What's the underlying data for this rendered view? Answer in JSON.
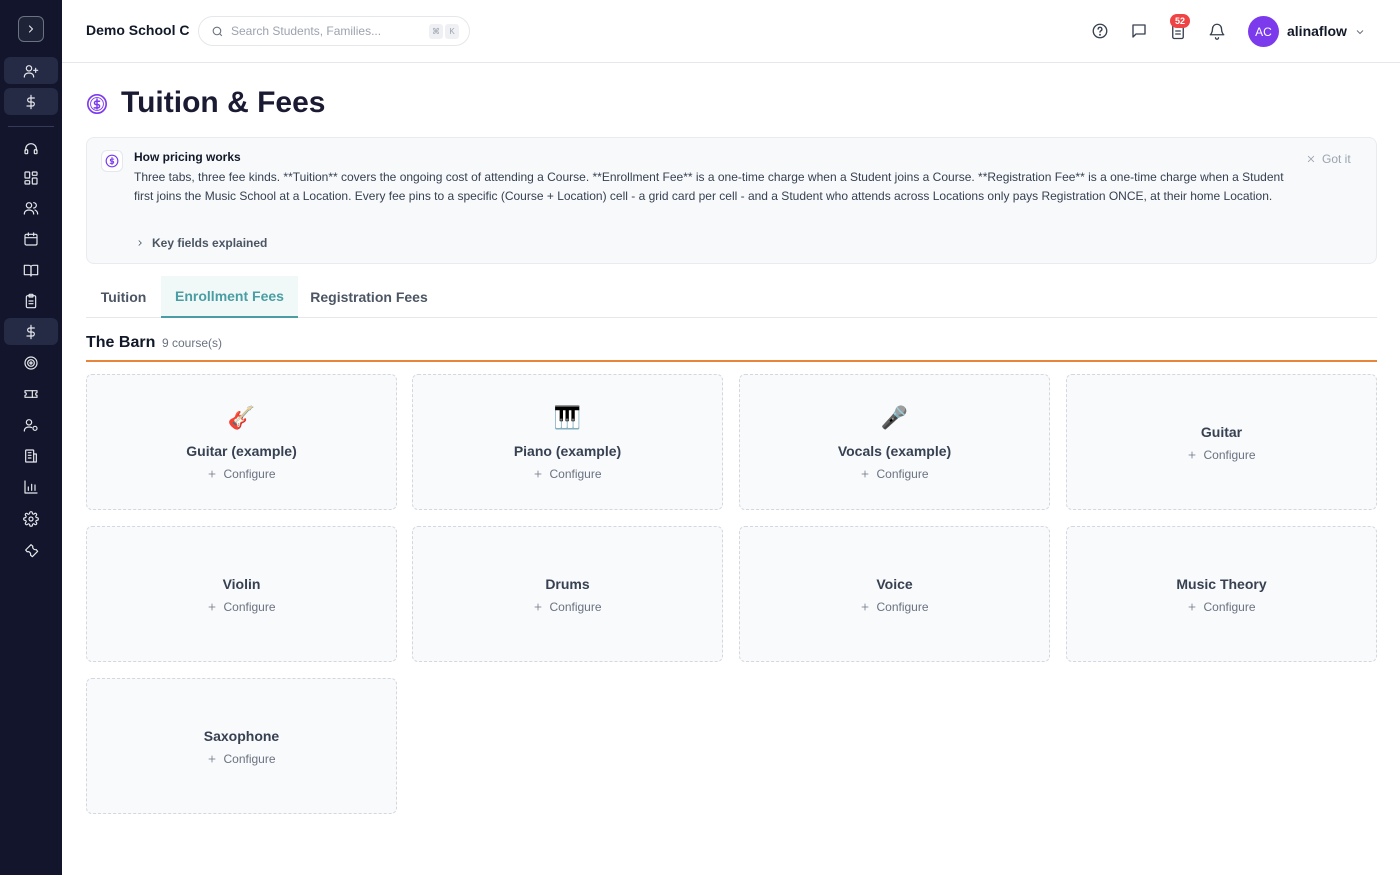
{
  "header": {
    "school_name": "Demo School C",
    "search_placeholder": "Search Students, Families...",
    "search_shortcut": [
      "⌘",
      "K"
    ],
    "notification_badge": "52",
    "avatar_initials": "AC",
    "username": "alinaflow"
  },
  "page": {
    "title": "Tuition & Fees",
    "icon": "dollar-circle-icon"
  },
  "info": {
    "title": "How pricing works",
    "body": "Three tabs, three fee kinds. **Tuition** covers the ongoing cost of attending a Course. **Enrollment Fee** is a one-time charge when a Student joins a Course. **Registration Fee** is a one-time charge when a Student first joins the Music School at a Location. Every fee pins to a specific (Course + Location) cell - a grid card per cell - and a Student who attends across Locations only pays Registration ONCE, at their home Location.",
    "dismiss_label": "Got it",
    "key_fields_label": "Key fields explained"
  },
  "tabs": [
    {
      "label": "Tuition",
      "active": false
    },
    {
      "label": "Enrollment Fees",
      "active": true
    },
    {
      "label": "Registration Fees",
      "active": false
    }
  ],
  "location": {
    "name": "The Barn",
    "count": "9 course(s)"
  },
  "configure_label": "Configure",
  "courses": [
    {
      "name": "Guitar (example)",
      "emoji": "🎸"
    },
    {
      "name": "Piano (example)",
      "emoji": "🎹"
    },
    {
      "name": "Vocals (example)",
      "emoji": "🎤"
    },
    {
      "name": "Guitar",
      "emoji": ""
    },
    {
      "name": "Violin",
      "emoji": ""
    },
    {
      "name": "Drums",
      "emoji": ""
    },
    {
      "name": "Voice",
      "emoji": ""
    },
    {
      "name": "Music Theory",
      "emoji": ""
    },
    {
      "name": "Saxophone",
      "emoji": ""
    }
  ],
  "colors": {
    "sidebar_bg": "#12152b",
    "accent_teal": "#4a9ea3",
    "location_rule": "#e8843c",
    "avatar": "#7c3aed",
    "badge": "#ef4444",
    "title_icon": "#7c3aed"
  },
  "sidebar_icons": [
    "chevron-right-icon",
    "user-plus-icon",
    "dollar-icon",
    "headset-icon",
    "dashboard-icon",
    "users-icon",
    "calendar-icon",
    "book-icon",
    "clipboard-icon",
    "dollar-icon",
    "target-icon",
    "ticket-icon",
    "user-gear-icon",
    "building-icon",
    "chart-icon",
    "settings-icon",
    "wrench-icon"
  ]
}
